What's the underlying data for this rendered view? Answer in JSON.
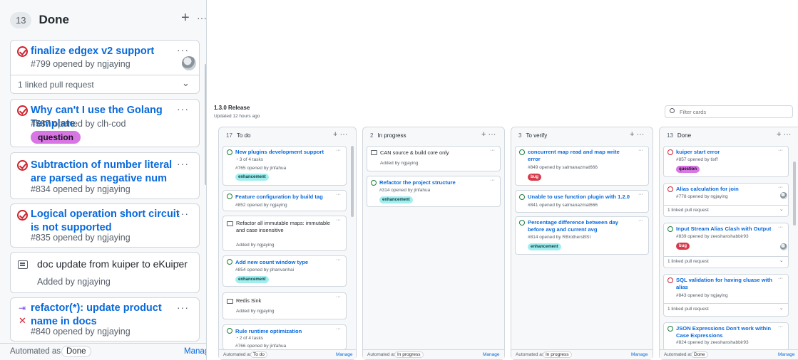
{
  "zoom": {
    "count": "13",
    "title": "Done",
    "plus": "+",
    "more": "···",
    "cards": [
      {
        "title": "finalize edgex v2 support",
        "sub": "#799 opened by ngjaying",
        "linked": "1 linked pull request"
      },
      {
        "title": "Why can't I use the Golang Template",
        "sub": "#587 opened by clh-cod",
        "label": "question"
      },
      {
        "title": "Subtraction of number literal are parsed as negative num",
        "sub": "#834 opened by ngjaying"
      },
      {
        "title": "Logical operation short circuit is not supported",
        "sub": "#835 opened by ngjaying"
      },
      {
        "title": "doc update from kuiper to eKuiper",
        "sub": "Added by ngjaying"
      },
      {
        "title": "refactor(*): update product name in docs",
        "sub": "#840 opened by ngjaying"
      }
    ],
    "footer": {
      "text": "Automated as",
      "pill": "Done",
      "manage": "Manage"
    }
  },
  "board": {
    "title": "1.3.0 Release",
    "updated": "Updated 12 hours ago",
    "filter_placeholder": "Filter cards"
  },
  "columns": [
    {
      "count": "17",
      "title": "To do",
      "cards": [
        {
          "title": "New plugins development support",
          "tasks": "3 of 4 tasks",
          "sub": "#765 opened by jinfahua",
          "label": "enhancement"
        },
        {
          "title": "Feature configuration by build tag",
          "sub": "#852 opened by ngjaying"
        },
        {
          "title": "Refactor all immutable maps: immutable and case insensitive",
          "sub": "Added by ngjaying"
        },
        {
          "title": "Add new count window type",
          "sub": "#854 opened by phanvanhai",
          "label": "enhancement"
        },
        {
          "title": "Redis Sink",
          "sub": "Added by ngjaying"
        },
        {
          "title": "Rule runtime optimization",
          "tasks": "2 of 4 tasks",
          "sub": "#766 opened by jinfahua"
        }
      ],
      "footer": {
        "text": "Automated as",
        "pill": "To do",
        "manage": "Manage"
      }
    },
    {
      "count": "2",
      "title": "In progress",
      "cards": [
        {
          "title": "CAN source & build core only",
          "sub": "Added by ngjaying"
        },
        {
          "title": "Refactor the project structure",
          "sub": "#314 opened by jinfahua",
          "label": "enhancement"
        }
      ],
      "footer": {
        "text": "Automated as",
        "pill": "In progress",
        "manage": "Manage"
      }
    },
    {
      "count": "3",
      "title": "To verify",
      "cards": [
        {
          "title": "concurrent map read and map write error",
          "sub": "#849 opened by salmanazmat666",
          "label": "bug"
        },
        {
          "title": "Unable to use function plugin with 1.2.0",
          "sub": "#841 opened by salmanazmat666"
        },
        {
          "title": "Percentage difference between day before avg and current avg",
          "sub": "#814 opened by RBrothersBSI",
          "label": "enhancement"
        }
      ],
      "footer": {
        "text": "Automated as",
        "pill": "In progress",
        "manage": "Manage"
      }
    },
    {
      "count": "13",
      "title": "Done",
      "cards": [
        {
          "title": "kuiper start error",
          "sub": "#857 opened by tixff",
          "label": "question"
        },
        {
          "title": "Alias calculation for join",
          "sub": "#778 opened by ngjaying",
          "linked": "1 linked pull request"
        },
        {
          "title": "Input Stream Alias Clash with Output",
          "sub": "#839 opened by zeeshanshabbir93",
          "label": "bug",
          "linked": "1 linked pull request"
        },
        {
          "title": "SQL validation for having cluase with alias",
          "sub": "#843 opened by ngjaying",
          "linked": "1 linked pull request"
        },
        {
          "title": "JSON Expressions Don't work within Case Expressions",
          "sub": "#824 opened by zeeshanshabbir93"
        }
      ],
      "footer": {
        "text": "Automated as",
        "pill": "Done",
        "manage": "Manage"
      }
    }
  ],
  "colors": {
    "link": "#0969da",
    "open": "#1a7f37",
    "closed": "#cf222e"
  },
  "icons": [
    "plus-icon",
    "more-icon",
    "issue-closed-icon",
    "issue-open-icon",
    "note-icon",
    "pull-request-icon",
    "chevron-down-icon",
    "search-icon",
    "avatar"
  ]
}
